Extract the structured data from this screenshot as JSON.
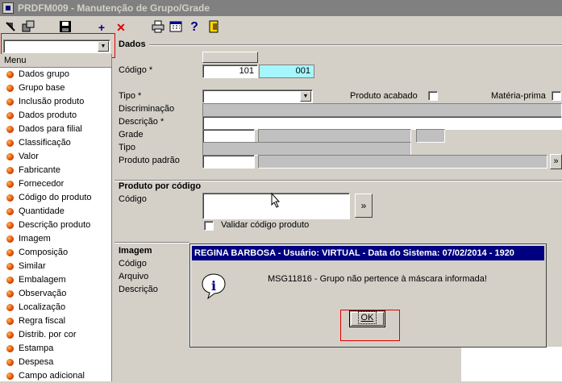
{
  "window": {
    "title": "PRDFM009 - Manutenção de Grupo/Grade"
  },
  "toolbar": {
    "icons": [
      "arrow-icon",
      "windows-icon",
      "save-icon",
      "add-icon",
      "delete-icon",
      "print-icon",
      "calendar-icon",
      "help-icon",
      "exit-icon"
    ],
    "add_glyph": "+",
    "delete_glyph": "✕",
    "help_glyph": "?"
  },
  "sidebar": {
    "combo_value": "",
    "header": "Menu",
    "items": [
      "Dados grupo",
      "Grupo base",
      "Inclusão produto",
      "Dados produto",
      "Dados para filial",
      "Classificação",
      "Valor",
      "Fabricante",
      "Fornecedor",
      "Código do produto",
      "Quantidade",
      "Descrição produto",
      "Imagem",
      "Composição",
      "Similar",
      "Embalagem",
      "Observação",
      "Localização",
      "Regra fiscal",
      "Distrib. por cor",
      "Estampa",
      "Despesa",
      "Campo adicional"
    ]
  },
  "dados": {
    "title": "Dados",
    "codigo_label": "Código *",
    "codigo_value_1": "101",
    "codigo_value_2": "001",
    "tipo_label": "Tipo *",
    "tipo_value": "",
    "produto_acabado_label": "Produto acabado",
    "materia_prima_label": "Matéria-prima",
    "discriminacao_label": "Discriminação",
    "descricao_label": "Descrição *",
    "grade_label": "Grade",
    "tipo2_label": "Tipo",
    "produto_padrao_label": "Produto padrão",
    "lookup_glyph": "»"
  },
  "produto_por_codigo": {
    "title": "Produto por código",
    "codigo_label": "Código",
    "go_glyph": "»",
    "validar_label": "Validar código produto"
  },
  "imagem": {
    "title": "Imagem",
    "codigo_label": "Código",
    "arquivo_label": "Arquivo",
    "descricao_label": "Descrição"
  },
  "dialog": {
    "title": "REGINA BARBOSA - Usuário: VIRTUAL - Data do Sistema: 07/02/2014 - 1920",
    "message": "MSG11816 - Grupo não pertence à máscara informada!",
    "ok_label": "OK",
    "icon": "info-icon",
    "icon_glyph": "i"
  },
  "colors": {
    "titlebar_bg": "#808080",
    "dialog_title_bg": "#000080",
    "highlight_field": "#a6f6ff",
    "annotation_red": "#e00000"
  }
}
